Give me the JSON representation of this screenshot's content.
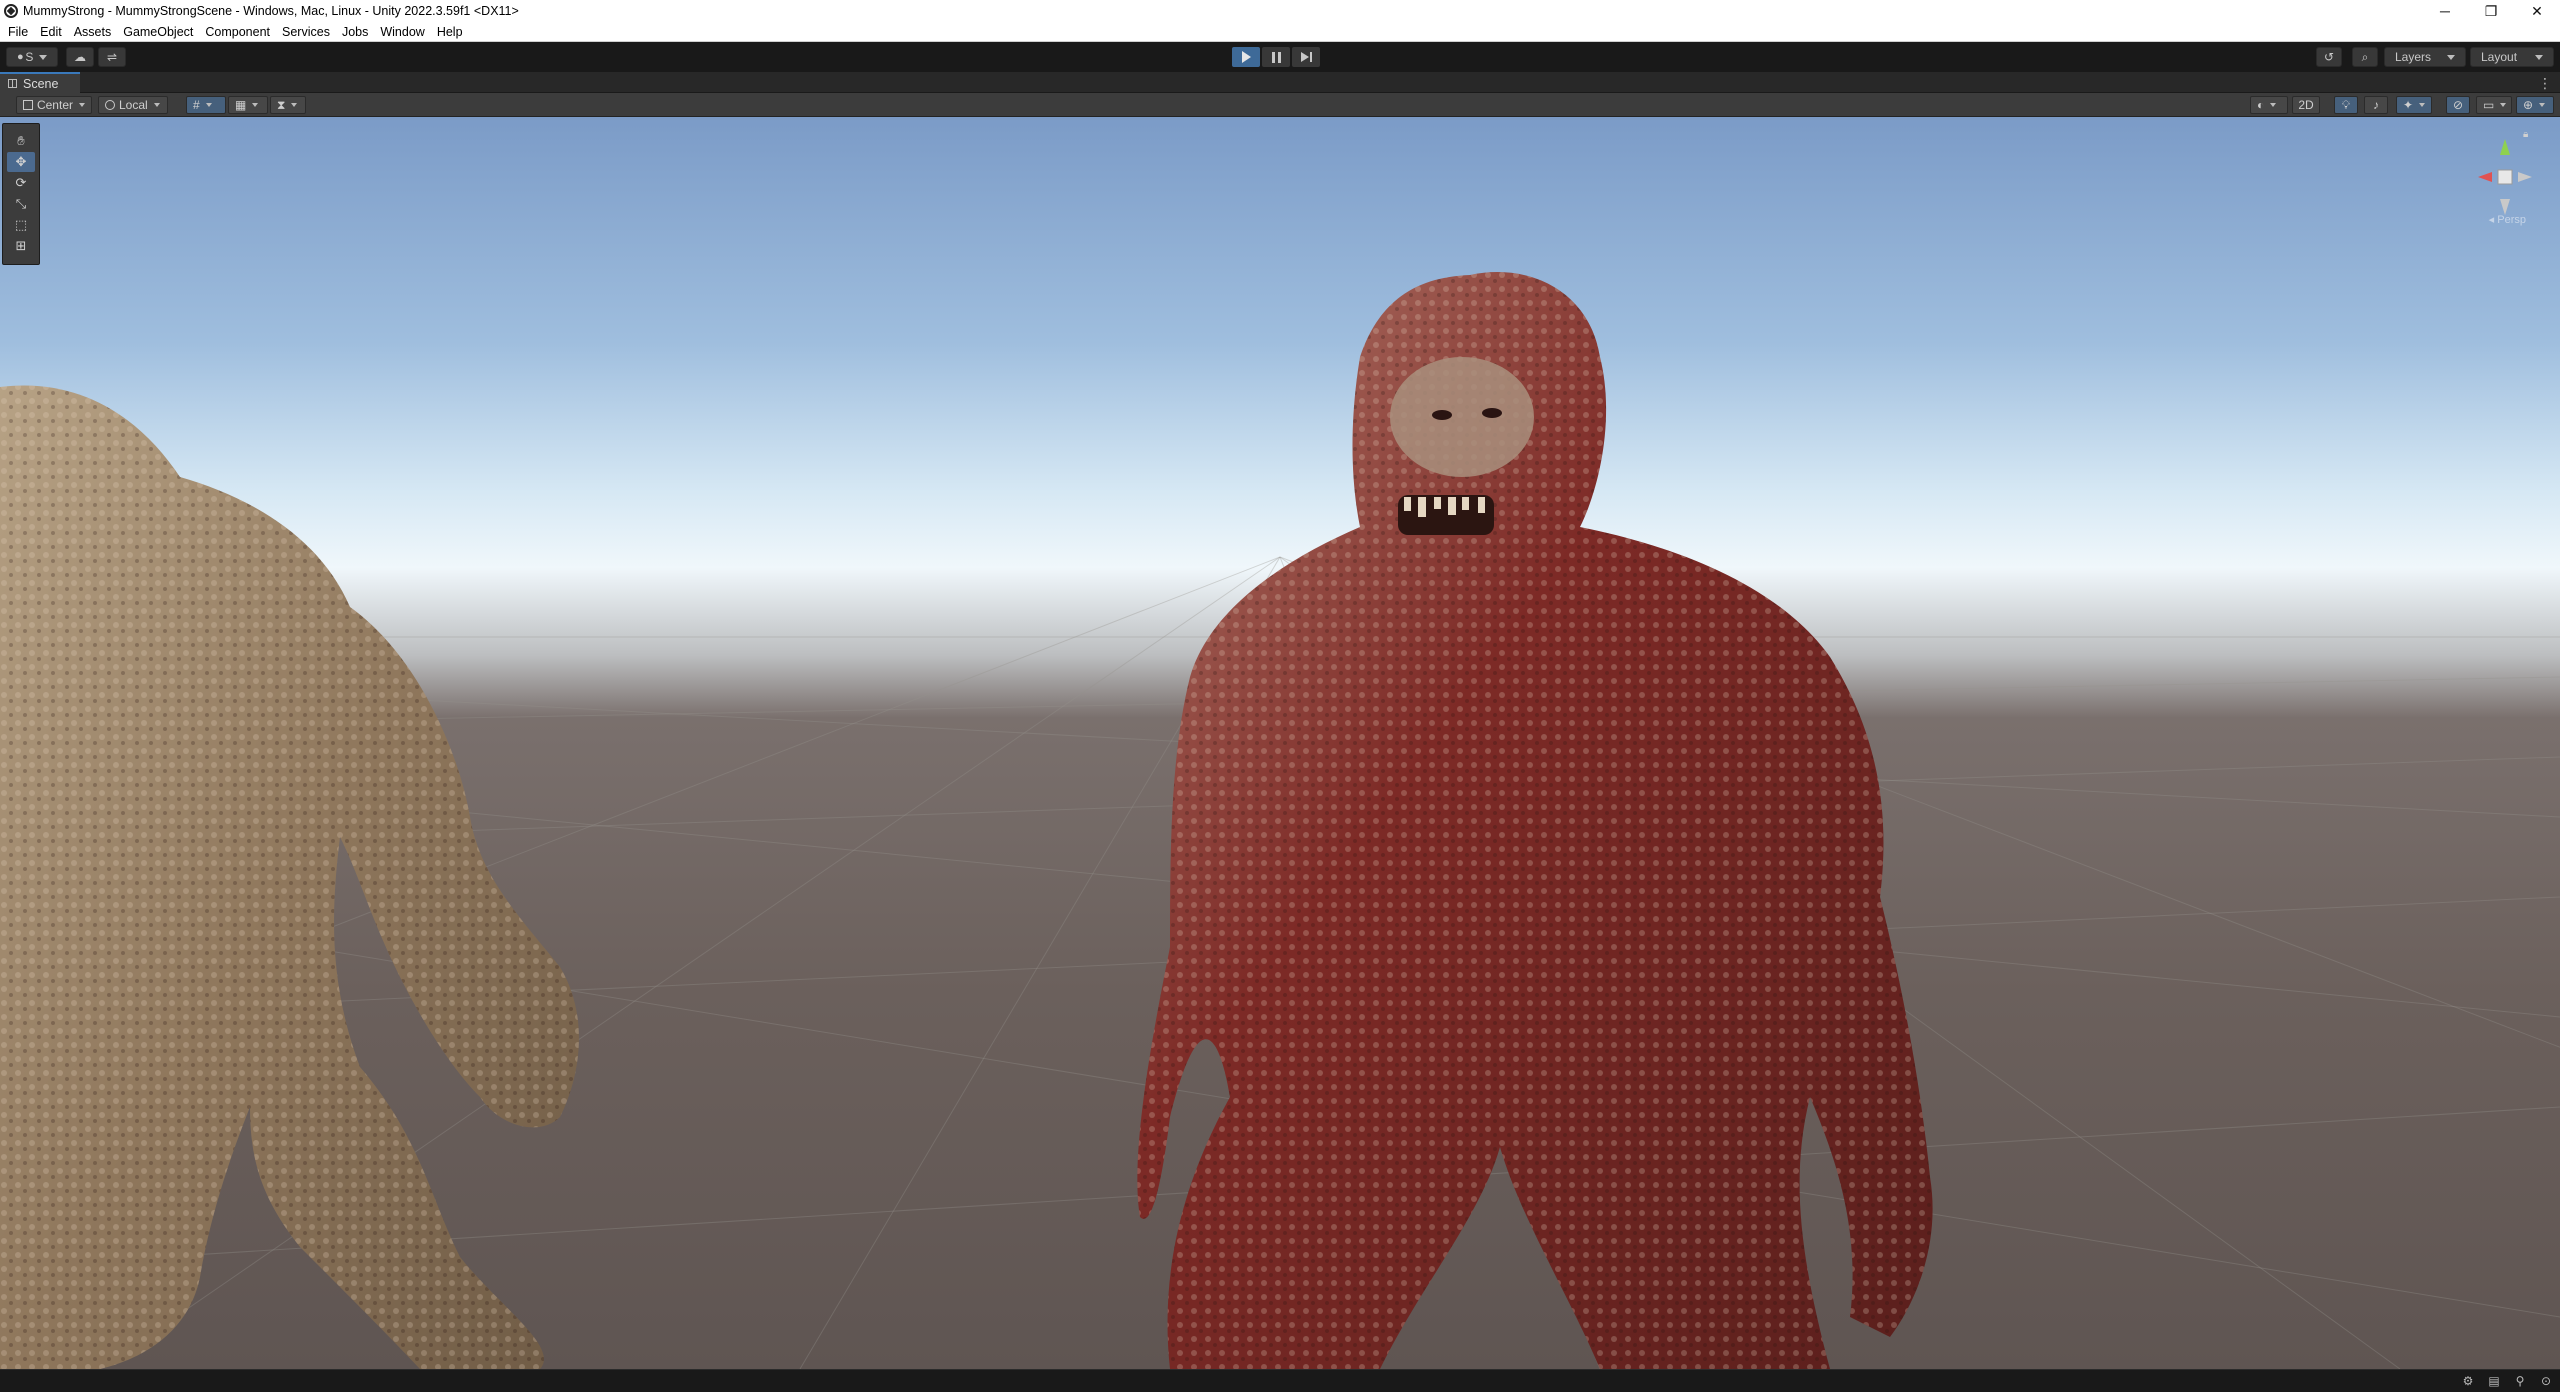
{
  "window": {
    "title": "MummyStrong - MummyStrongScene - Windows, Mac, Linux - Unity 2022.3.59f1 <DX11>",
    "minimize_glyph": "─",
    "restore_glyph": "❐",
    "close_glyph": "✕"
  },
  "menu": [
    "File",
    "Edit",
    "Assets",
    "GameObject",
    "Component",
    "Services",
    "Jobs",
    "Window",
    "Help"
  ],
  "toolbar": {
    "account_label": "S",
    "layers_label": "Layers",
    "layout_label": "Layout",
    "play_active": true
  },
  "scene_tab": {
    "label": "Scene"
  },
  "scene_toolbar": {
    "pivot_label": "Center",
    "space_label": "Local",
    "mode_2d_label": "2D"
  },
  "gizmo": {
    "projection_label": "◂ Persp"
  },
  "colors": {
    "accent": "#3e6a98",
    "sky_top": "#7b9bc7",
    "ground": "#6b605c",
    "creature_red": "#8a2f2a",
    "creature_tan": "#9b8468"
  }
}
